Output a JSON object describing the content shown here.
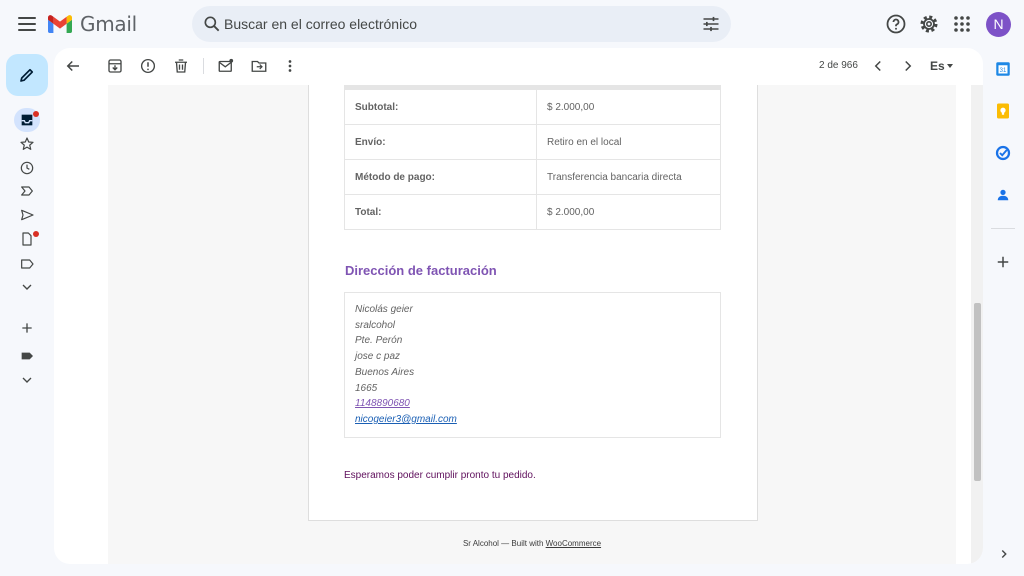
{
  "app": {
    "name": "Gmail",
    "avatar_letter": "N",
    "accent": "#7d52c7"
  },
  "search": {
    "placeholder": "Buscar en el correo electrónico"
  },
  "toolbar": {
    "pager": "2 de 966",
    "language": "Es"
  },
  "order_totals": [
    {
      "label": "Subtotal:",
      "value": "$ 2.000,00"
    },
    {
      "label": "Envío:",
      "value": "Retiro en el local"
    },
    {
      "label": "Método de pago:",
      "value": "Transferencia bancaria directa"
    },
    {
      "label": "Total:",
      "value": "$ 2.000,00"
    }
  ],
  "billing": {
    "title": "Dirección de facturación",
    "name": "Nicolás geier",
    "company": "sralcohol",
    "street": "Pte. Perón",
    "city": "jose c paz",
    "state": "Buenos Aires",
    "postcode": "1665",
    "phone": "1148890680",
    "email": "nicogeier3@gmail.com"
  },
  "closing": "Esperamos poder cumplir pronto tu pedido.",
  "footer": {
    "prefix": "Sr Alcohol — Built with ",
    "link": "WooCommerce"
  },
  "colors": {
    "woo_purple": "#7f54b3",
    "compose_bg": "#c2e7ff",
    "badge_red": "#d93025"
  }
}
